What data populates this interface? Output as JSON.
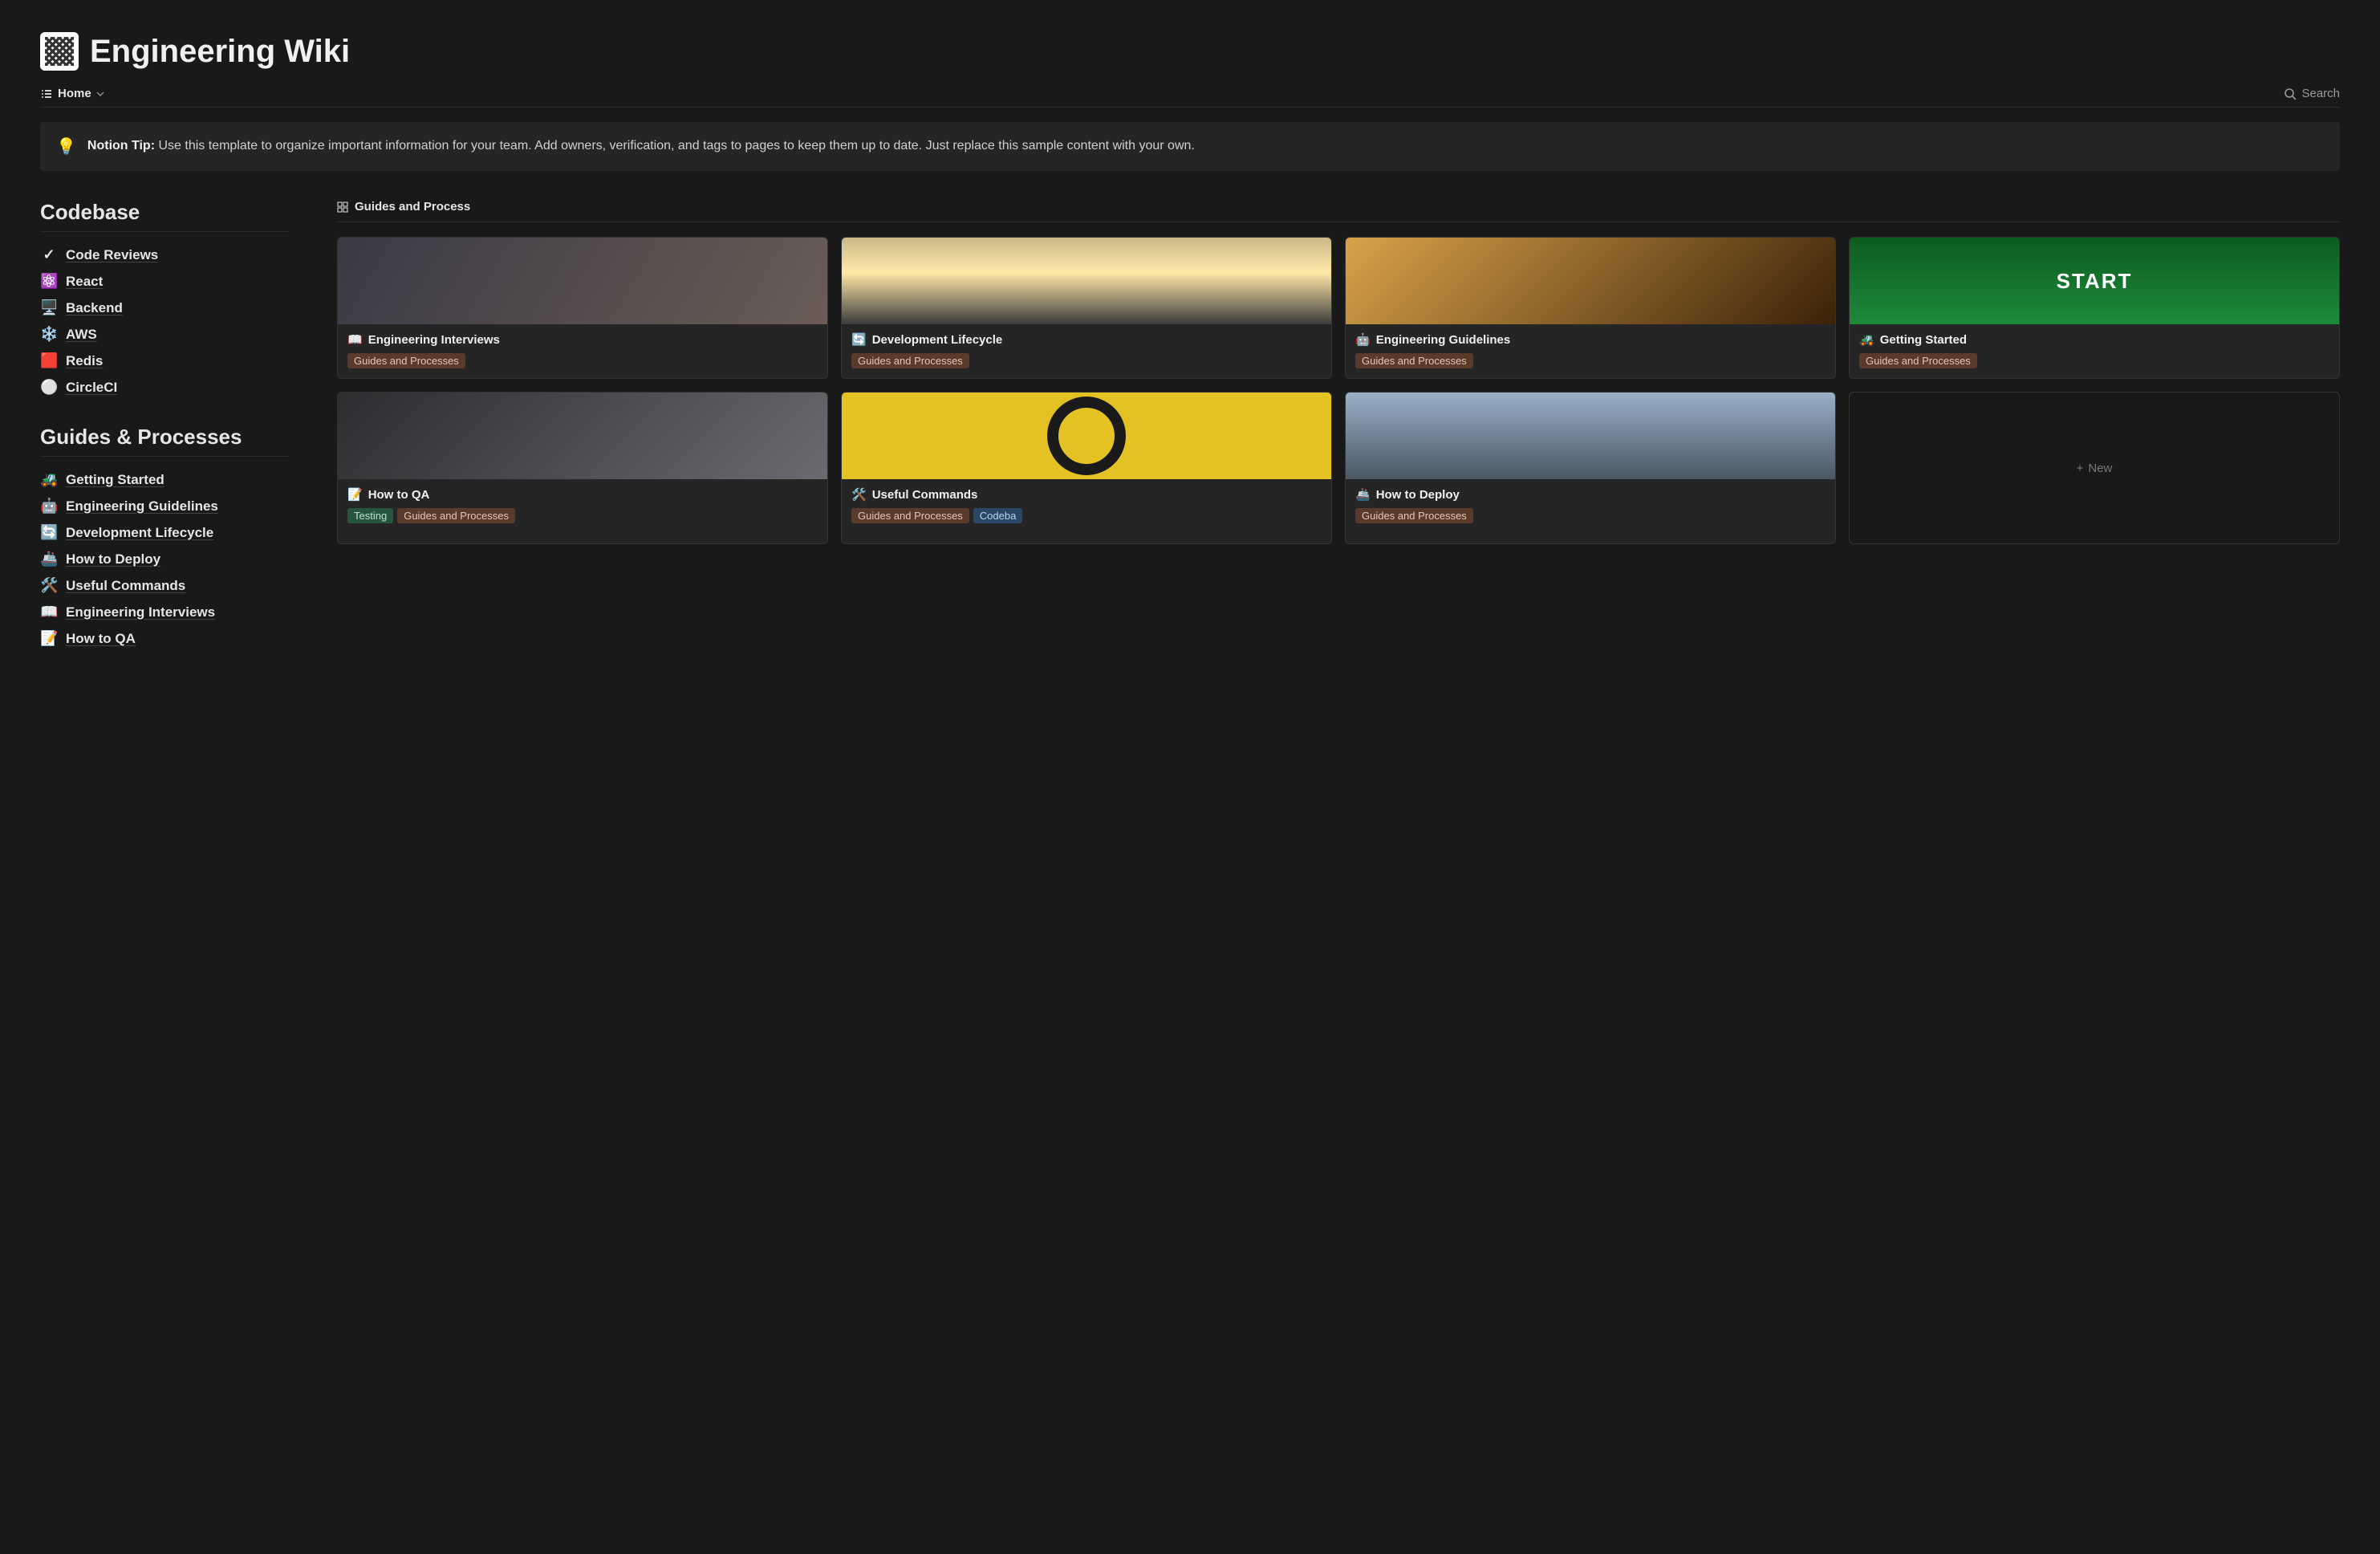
{
  "header": {
    "title": "Engineering Wiki"
  },
  "toolbar": {
    "view_label": "Home",
    "search_label": "Search"
  },
  "callout": {
    "icon": "💡",
    "bold": "Notion Tip:",
    "text": "Use this template to organize important information for your team. Add owners, verification, and tags to pages to keep them up to date. Just replace this sample content with your own."
  },
  "sidebar": {
    "sections": [
      {
        "heading": "Codebase",
        "items": [
          {
            "icon": "✓",
            "label": "Code Reviews"
          },
          {
            "icon": "⚛️",
            "label": "React"
          },
          {
            "icon": "🖥️",
            "label": "Backend"
          },
          {
            "icon": "❄️",
            "label": "AWS"
          },
          {
            "icon": "🟥",
            "label": "Redis"
          },
          {
            "icon": "⚪",
            "label": "CircleCI"
          }
        ]
      },
      {
        "heading": "Guides & Processes",
        "items": [
          {
            "icon": "🚜",
            "label": "Getting Started"
          },
          {
            "icon": "🤖",
            "label": "Engineering Guidelines"
          },
          {
            "icon": "🔄",
            "label": "Development Lifecycle"
          },
          {
            "icon": "🚢",
            "label": "How to Deploy"
          },
          {
            "icon": "🛠️",
            "label": "Useful Commands"
          },
          {
            "icon": "📖",
            "label": "Engineering Interviews"
          },
          {
            "icon": "📝",
            "label": "How to QA"
          }
        ]
      }
    ]
  },
  "gallery": {
    "heading": "Guides and Process",
    "new_label": "New",
    "cards": [
      {
        "icon": "📖",
        "title": "Engineering Interviews",
        "tags": [
          {
            "text": "Guides and Processes",
            "cls": "tag-brown"
          }
        ]
      },
      {
        "icon": "🔄",
        "title": "Development Lifecycle",
        "tags": [
          {
            "text": "Guides and Processes",
            "cls": "tag-brown"
          }
        ]
      },
      {
        "icon": "🤖",
        "title": "Engineering Guidelines",
        "tags": [
          {
            "text": "Guides and Processes",
            "cls": "tag-brown"
          }
        ]
      },
      {
        "icon": "🚜",
        "title": "Getting Started",
        "tags": [
          {
            "text": "Guides and Processes",
            "cls": "tag-brown"
          }
        ]
      },
      {
        "icon": "📝",
        "title": "How to QA",
        "tags": [
          {
            "text": "Testing",
            "cls": "tag-green"
          },
          {
            "text": "Guides and Processes",
            "cls": "tag-brown"
          }
        ]
      },
      {
        "icon": "🛠️",
        "title": "Useful Commands",
        "tags": [
          {
            "text": "Guides and Processes",
            "cls": "tag-brown"
          },
          {
            "text": "Codeba",
            "cls": "tag-blue"
          }
        ]
      },
      {
        "icon": "🚢",
        "title": "How to Deploy",
        "tags": [
          {
            "text": "Guides and Processes",
            "cls": "tag-brown"
          }
        ]
      }
    ]
  }
}
